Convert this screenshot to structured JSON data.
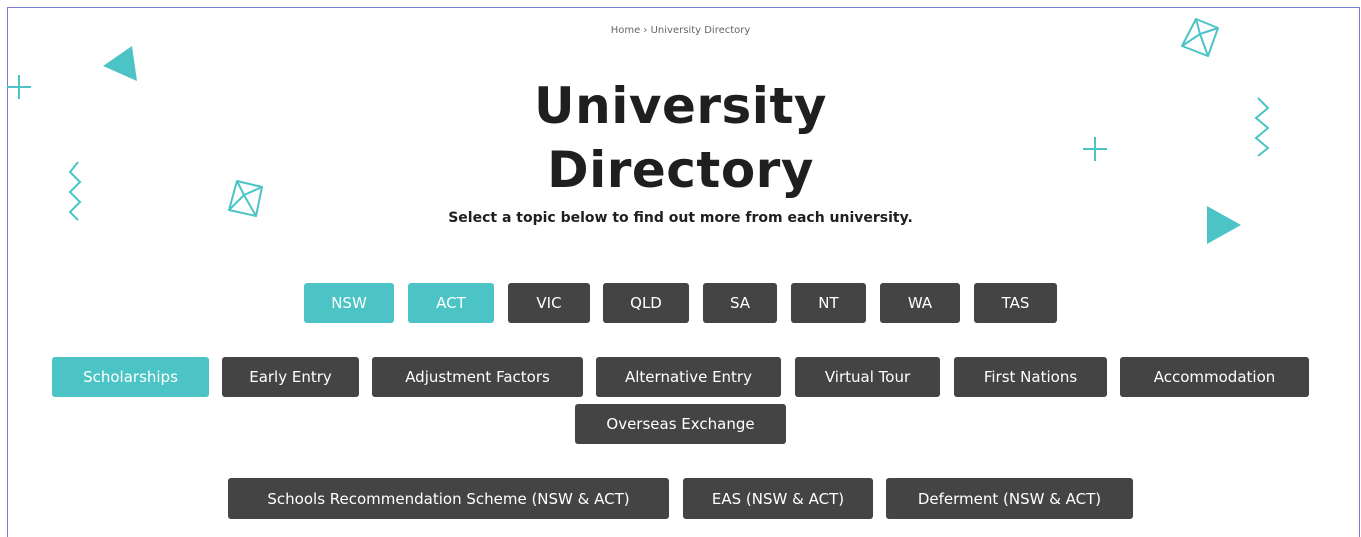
{
  "breadcrumb": {
    "home": "Home",
    "separator": "›",
    "current": "University Directory"
  },
  "header": {
    "title_line1": "University",
    "title_line2": "Directory",
    "subtitle": "Select a topic below to find out more from each university."
  },
  "states": [
    {
      "label": "NSW",
      "active": true
    },
    {
      "label": "ACT",
      "active": true
    },
    {
      "label": "VIC",
      "active": false
    },
    {
      "label": "QLD",
      "active": false
    },
    {
      "label": "SA",
      "active": false
    },
    {
      "label": "NT",
      "active": false
    },
    {
      "label": "WA",
      "active": false
    },
    {
      "label": "TAS",
      "active": false
    }
  ],
  "topics": [
    {
      "label": "Scholarships",
      "active": true
    },
    {
      "label": "Early Entry",
      "active": false
    },
    {
      "label": "Adjustment Factors",
      "active": false
    },
    {
      "label": "Alternative Entry",
      "active": false
    },
    {
      "label": "Virtual Tour",
      "active": false
    },
    {
      "label": "First Nations",
      "active": false
    },
    {
      "label": "Accommodation",
      "active": false
    },
    {
      "label": "Overseas Exchange",
      "active": false
    }
  ],
  "programs": [
    {
      "label": "Schools Recommendation Scheme (NSW & ACT)"
    },
    {
      "label": "EAS (NSW & ACT)"
    },
    {
      "label": "Deferment (NSW & ACT)"
    }
  ],
  "colors": {
    "accent": "#4cc4c6",
    "button": "#444444",
    "text": "#1f1f1f"
  }
}
